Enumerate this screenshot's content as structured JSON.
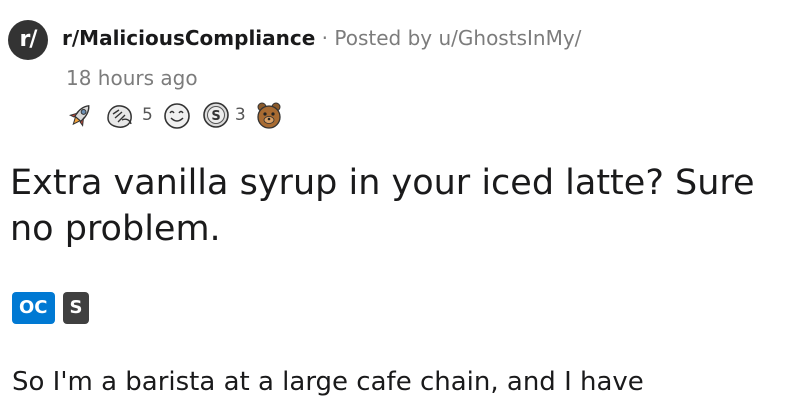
{
  "post": {
    "subreddit_icon": "r/",
    "subreddit": "r/MaliciousCompliance",
    "separator": "·",
    "posted_by": "Posted by u/GhostsInMy/",
    "time": "18 hours ago",
    "awards": [
      {
        "icon": "rocket-award-icon",
        "count": ""
      },
      {
        "icon": "helpful-hands-award-icon",
        "count": "5"
      },
      {
        "icon": "wholesome-face-award-icon",
        "count": ""
      },
      {
        "icon": "silver-coin-award-icon",
        "count": "3"
      },
      {
        "icon": "bear-award-icon",
        "count": ""
      }
    ],
    "title": "Extra vanilla syrup in your iced latte? Sure no problem.",
    "flairs": [
      {
        "label": "OC",
        "color": "#0079d3"
      },
      {
        "label": "S",
        "color": "#404040"
      }
    ],
    "body": "So I'm a barista at a large cafe chain, and I have"
  }
}
